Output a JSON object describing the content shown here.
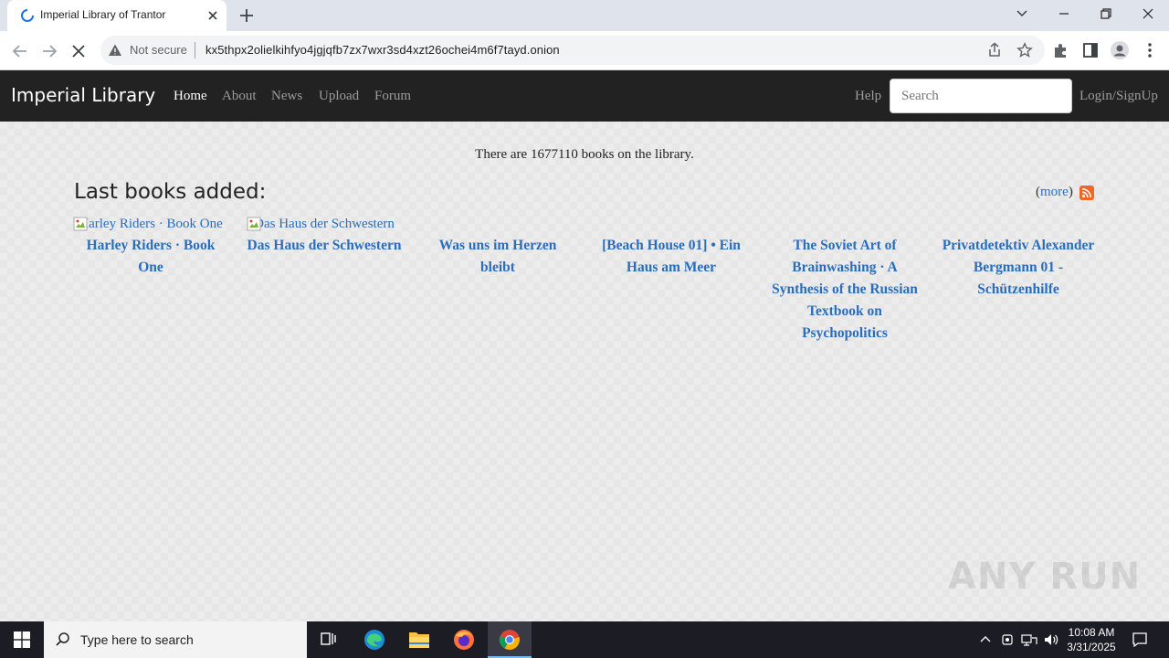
{
  "browser": {
    "tab_title": "Imperial Library of Trantor",
    "security_label": "Not secure",
    "url": "kx5thpx2olielkihfyo4jgjqfb7zx7wxr3sd4xzt26ochei4m6f7tayd.onion"
  },
  "site": {
    "brand": "Imperial Library",
    "nav": [
      "Home",
      "About",
      "News",
      "Upload",
      "Forum"
    ],
    "help_label": "Help",
    "search_placeholder": "Search",
    "login_label": "Login/SignUp"
  },
  "main": {
    "count_text": "There are 1677110 books on the library.",
    "heading": "Last books added:",
    "more_open": "(",
    "more_label": "more",
    "more_close": ")",
    "books": [
      {
        "cover_alt": "Harley Riders · Book One",
        "title": "Harley Riders · Book One"
      },
      {
        "cover_alt": "Das Haus der Schwestern",
        "title": "Das Haus der Schwestern"
      },
      {
        "cover_alt": "",
        "title": "Was uns im Herzen bleibt"
      },
      {
        "cover_alt": "",
        "title": "[Beach House 01] • Ein Haus am Meer"
      },
      {
        "cover_alt": "",
        "title": "The Soviet Art of Brainwashing · A Synthesis of the Russian Textbook on Psychopolitics"
      },
      {
        "cover_alt": "",
        "title": "Privatdetektiv Alexander Bergmann 01 - Schützenhilfe"
      }
    ]
  },
  "watermark": "ANY RUN",
  "taskbar": {
    "search_placeholder": "Type here to search",
    "time": "10:08 AM",
    "date": "3/31/2025"
  },
  "colors": {
    "nav_bg": "#222222",
    "link": "#2a6ebb",
    "rss": "#f26522",
    "taskbar_bg": "#1c1c24"
  },
  "icons": [
    "loading-spinner-icon",
    "close-icon",
    "plus-icon",
    "chevron-down-icon",
    "minimize-icon",
    "restore-icon",
    "back-arrow-icon",
    "forward-arrow-icon",
    "stop-loading-icon",
    "warning-icon",
    "share-icon",
    "star-icon",
    "puzzle-icon",
    "sidebar-icon",
    "profile-icon",
    "kebab-menu-icon",
    "rss-icon",
    "broken-image-icon",
    "windows-logo-icon",
    "search-icon",
    "task-view-icon",
    "edge-icon",
    "file-explorer-icon",
    "firefox-icon",
    "chrome-icon",
    "chevron-up-icon",
    "network-icon",
    "speaker-icon",
    "notification-icon"
  ]
}
